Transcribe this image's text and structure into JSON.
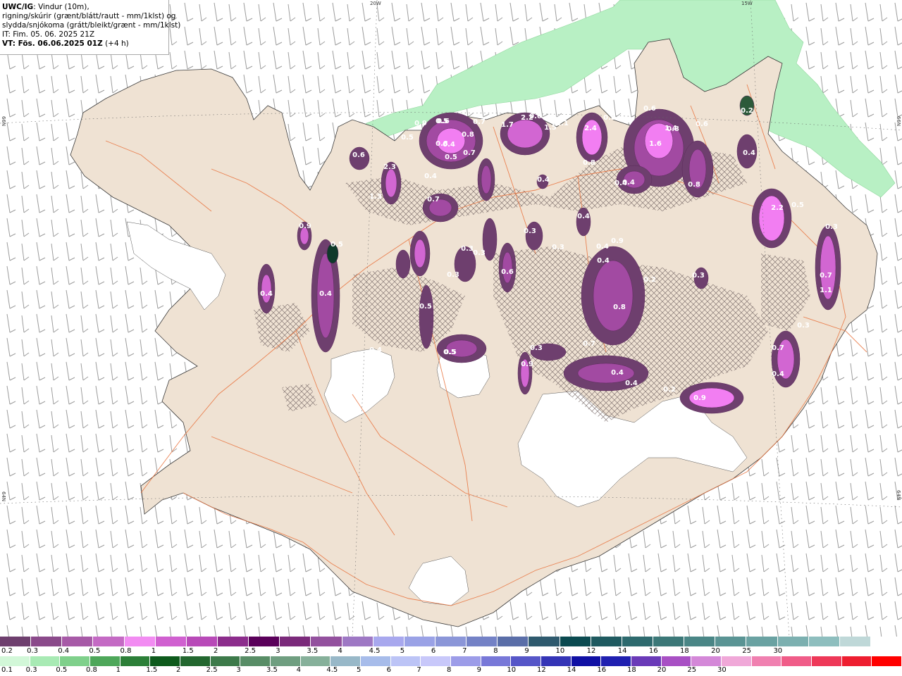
{
  "header": {
    "model": "UWC/IG",
    "line1_rest": ": Vindur (10m),",
    "line2": "rigning/skúrir (grænt/blátt/rautt - mm/1klst) og",
    "line3": "slydda/snjókoma (grátt/bleikt/grænt - mm/1klst)",
    "line4": "IT: Fim. 05. 06. 2025 21Z",
    "line5_bold": "VT: Fös. 06.06.2025 01Z",
    "line5_rest": " (+4 h)"
  },
  "grid_labels": {
    "top_20w": "20W",
    "top_15w": "15W",
    "left_66n": "66N",
    "left_64n": "64N",
    "right_66n": "66N",
    "right_64n": "64N"
  },
  "colors": {
    "land": "#efe2d3",
    "ice": "#ffffff",
    "roads": "#e8703a",
    "rain_light": "#b2f2c0",
    "snow_1": "#6e3f6e",
    "snow_2": "#a24aa2",
    "snow_3": "#d266d2",
    "snow_4": "#f27ef2"
  },
  "precip_values": [
    "0.6",
    "0.5",
    "0.7",
    "0.5",
    "2.3",
    "0.6",
    "1.3",
    "0.9",
    "0.8",
    "0.4",
    "1.7",
    "2.2",
    "0.6",
    "0.4",
    "0.8",
    "0.5",
    "0.7",
    "0.4",
    "1.5",
    "1.1",
    "2.4",
    "0.8",
    "1.4",
    "0.6",
    "0.8",
    "1.6",
    "0.4",
    "0.8",
    "0.9",
    "0.5",
    "0.4",
    "0.4",
    "0.3",
    "0.3",
    "0.3",
    "0.7",
    "0.2",
    "0.3",
    "0.9",
    "0.5",
    "0.6",
    "0.5",
    "0.8",
    "0.3",
    "0.4",
    "0.4",
    "0.3",
    "0.4",
    "0.4",
    "0.4",
    "0.9",
    "0.2",
    "2.2",
    "0.5",
    "0.3",
    "0.8",
    "0.7",
    "1.1",
    "0.3",
    "0.7",
    "0.4",
    "0.9",
    "0.5",
    "0.4",
    "0.7",
    "0.6",
    "0.4",
    "0.2",
    "0.3",
    "0.4",
    "0.3"
  ],
  "colorbar_snow": {
    "colors": [
      "#6e3f6e",
      "#8a4a8a",
      "#a75aa7",
      "#c46ac4",
      "#f28cf2",
      "#d060d0",
      "#b84ab8",
      "#8c2d8c",
      "#5a005a",
      "#7b2a7b",
      "#93519e",
      "#9e78c4",
      "#a8a8ee",
      "#9aa2e6",
      "#8b96d8",
      "#7482c6",
      "#5a6ea8",
      "#2f5a6e",
      "#0b4a50",
      "#1f5a60",
      "#2e6a6e",
      "#3c7878",
      "#4a8686",
      "#5a9494",
      "#6aa2a2",
      "#7cb0b0",
      "#8ebebe",
      "#bfd8d8",
      "#ffffff"
    ],
    "labels": [
      "0.2",
      "0.3",
      "0.4",
      "0.5",
      "0.8",
      "1",
      "1.5",
      "2",
      "2.5",
      "3",
      "3.5",
      "4",
      "4.5",
      "5",
      "6",
      "7",
      "8",
      "9",
      "10",
      "12",
      "14",
      "16",
      "18",
      "20",
      "25",
      "30"
    ]
  },
  "colorbar_rain": {
    "colors": [
      "#d2f7d8",
      "#a8eab4",
      "#7fd08b",
      "#4ea75a",
      "#2c7f38",
      "#0e5a1c",
      "#23672f",
      "#3d7a4a",
      "#588d66",
      "#6f9e80",
      "#86b09a",
      "#98b8c8",
      "#a7bcea",
      "#bcc4f6",
      "#c8c8fa",
      "#9c9ce8",
      "#7878d8",
      "#5656c8",
      "#3434b6",
      "#1010a4",
      "#2020b0",
      "#6a3ab8",
      "#a850c4",
      "#d488d8",
      "#f0a8d8",
      "#f080b0",
      "#f05c88",
      "#ee3858",
      "#ee1e30",
      "#ff0000"
    ],
    "labels": [
      "0.1",
      "0.3",
      "0.5",
      "0.8",
      "1",
      "1.5",
      "2",
      "2.5",
      "3",
      "3.5",
      "4",
      "4.5",
      "5",
      "6",
      "7",
      "8",
      "9",
      "10",
      "12",
      "14",
      "16",
      "18",
      "20",
      "25",
      "30"
    ]
  }
}
